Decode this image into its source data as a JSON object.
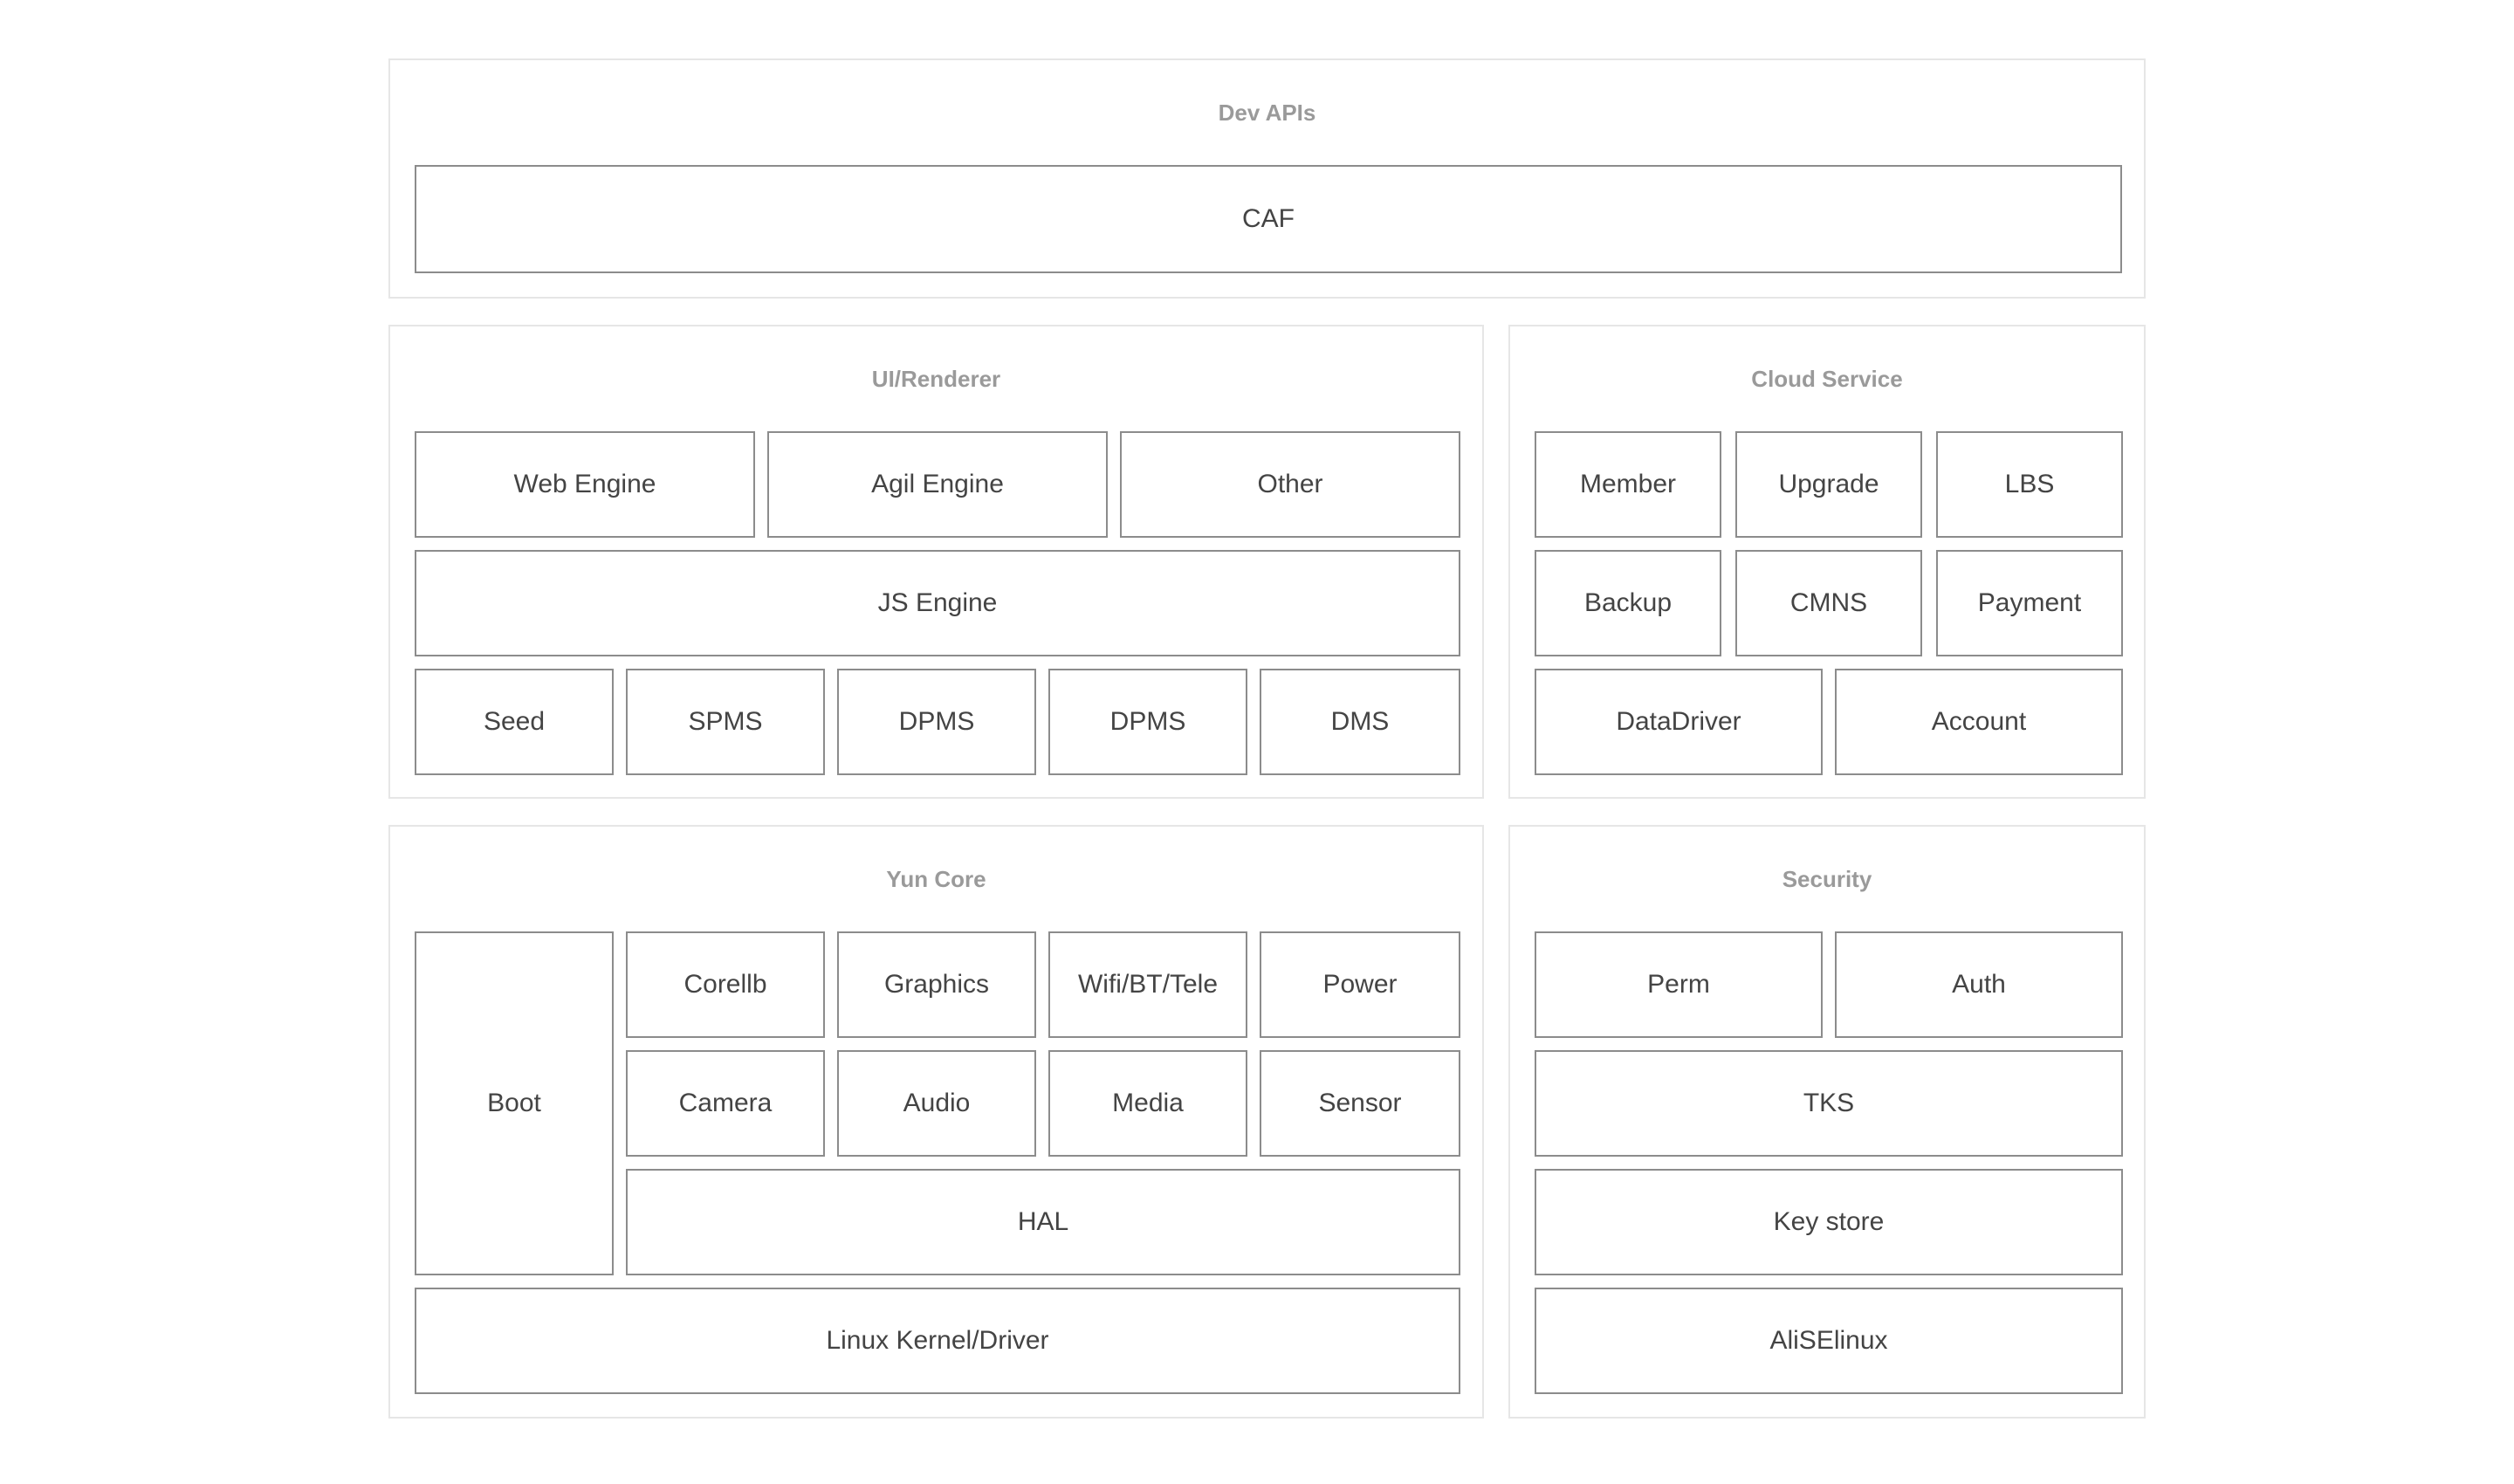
{
  "dev_apis": {
    "title": "Dev APIs",
    "caf": "CAF"
  },
  "ui_renderer": {
    "title": "UI/Renderer",
    "web_engine": "Web Engine",
    "agil_engine": "Agil Engine",
    "other": "Other",
    "js_engine": "JS Engine",
    "seed": "Seed",
    "spms": "SPMS",
    "dpms_1": "DPMS",
    "dpms_2": "DPMS",
    "dms": "DMS"
  },
  "cloud_service": {
    "title": "Cloud Service",
    "member": "Member",
    "upgrade": "Upgrade",
    "lbs": "LBS",
    "backup": "Backup",
    "cmns": "CMNS",
    "payment": "Payment",
    "datadriver": "DataDriver",
    "account": "Account"
  },
  "yun_core": {
    "title": "Yun Core",
    "boot": "Boot",
    "corelib": "Corellb",
    "graphics": "Graphics",
    "wifi_bt_tele": "Wifi/BT/Tele",
    "power": "Power",
    "camera": "Camera",
    "audio": "Audio",
    "media": "Media",
    "sensor": "Sensor",
    "hal": "HAL",
    "linux_kernel": "Linux Kernel/Driver"
  },
  "security": {
    "title": "Security",
    "perm": "Perm",
    "auth": "Auth",
    "tks": "TKS",
    "key_store": "Key store",
    "aliselinux": "AliSElinux"
  }
}
